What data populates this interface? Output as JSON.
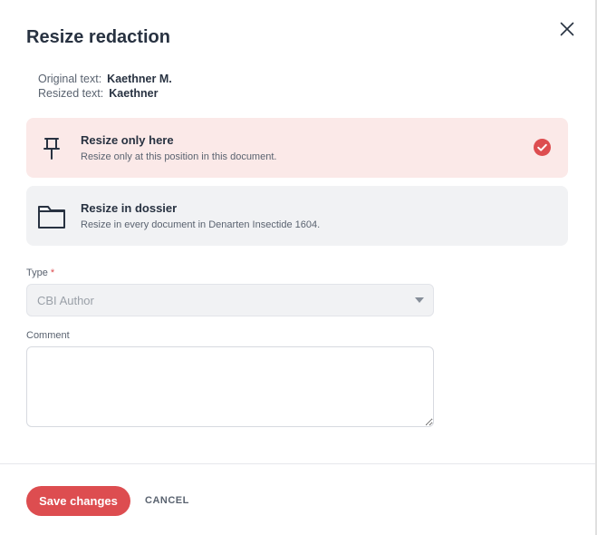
{
  "dialog": {
    "title": "Resize redaction"
  },
  "info": {
    "original_label": "Original text:",
    "original_value": "Kaethner M.",
    "resized_label": "Resized text:",
    "resized_value": "Kaethner"
  },
  "options": [
    {
      "title": "Resize only here",
      "description": "Resize only at this position in this document.",
      "icon": "pin-icon",
      "selected": true
    },
    {
      "title": "Resize in dossier",
      "description": "Resize in every document in Denarten Insectide 1604.",
      "icon": "folder-icon",
      "selected": false
    }
  ],
  "type_field": {
    "label": "Type",
    "required_mark": "*",
    "value": "CBI Author"
  },
  "comment_field": {
    "label": "Comment",
    "value": ""
  },
  "actions": {
    "save_label": "Save changes",
    "cancel_label": "CANCEL"
  },
  "colors": {
    "accent": "#dd4d50",
    "selected_bg": "#fbe9e8",
    "unselected_bg": "#f1f2f4",
    "text": "#283241"
  }
}
